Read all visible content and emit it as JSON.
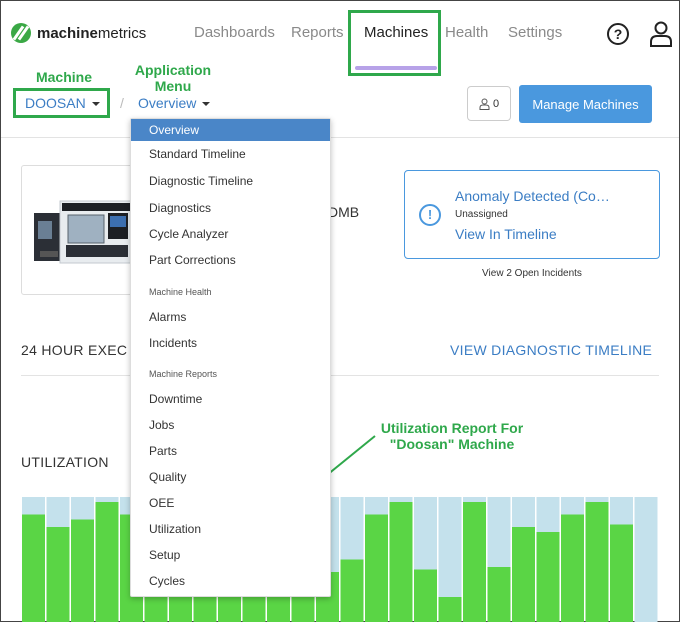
{
  "brand": {
    "name_bold": "machine",
    "name_rest": "metrics"
  },
  "nav": {
    "items": [
      "Dashboards",
      "Reports",
      "Machines",
      "Health",
      "Settings"
    ],
    "active": "Machines"
  },
  "header": {
    "machine_label": "DOOSAN",
    "separator": "/",
    "app_label": "Overview",
    "user_count": "0",
    "manage_button": "Manage Machines"
  },
  "machine": {
    "model_partial": "DMB"
  },
  "anomaly": {
    "title": "Anomaly Detected (Co…",
    "status": "Unassigned",
    "link": "View In Timeline",
    "open_incidents": "View 2 Open Incidents"
  },
  "sections": {
    "exec_title": "24 HOUR EXEC",
    "view_diag": "VIEW DIAGNOSTIC TIMELINE",
    "util_title": "UTILIZATION"
  },
  "dropdown": {
    "items": [
      "Overview",
      "Standard Timeline",
      "Diagnostic Timeline",
      "Diagnostics",
      "Cycle Analyzer",
      "Part Corrections"
    ],
    "health_header": "Machine Health",
    "health_items": [
      "Alarms",
      "Incidents"
    ],
    "reports_header": "Machine Reports",
    "reports_items": [
      "Downtime",
      "Jobs",
      "Parts",
      "Quality",
      "OEE",
      "Utilization",
      "Setup",
      "Cycles"
    ],
    "selected": "Overview"
  },
  "annotations": {
    "machine": "Machine",
    "app_menu_line1": "Application",
    "app_menu_line2": "Menu",
    "util_line1": "Utilization Report For",
    "util_line2": "\"Doosan\" Machine"
  },
  "colors": {
    "accent": "#4a98de",
    "annotation": "#2fa84b",
    "util_bar": "#5ad545",
    "util_bg": "#c4e1ec"
  },
  "util_levels": [
    0.86,
    0.76,
    0.82,
    0.96,
    0.86,
    0.54,
    0.92,
    0.22,
    0.2,
    0.28,
    0.24,
    0.36,
    0.4,
    0.5,
    0.86,
    0.96,
    0.42,
    0.2,
    0.96,
    0.44,
    0.76,
    0.72,
    0.86,
    0.96,
    0.78,
    0.0
  ]
}
